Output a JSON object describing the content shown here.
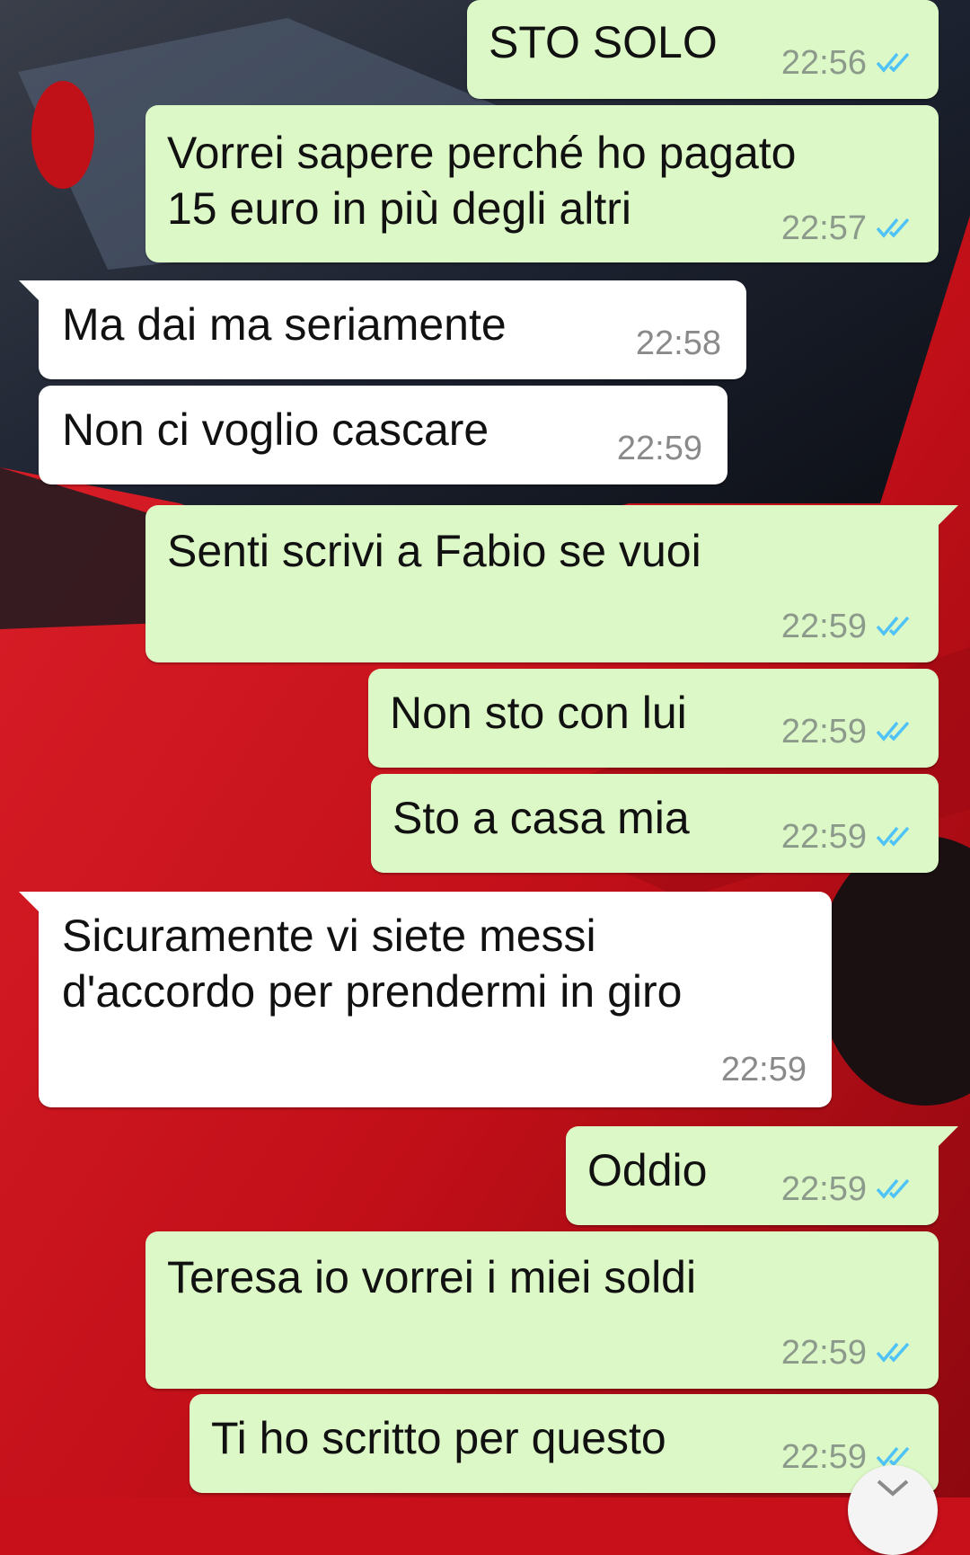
{
  "colors": {
    "outgoing_bubble": "#dcf8c6",
    "incoming_bubble": "#ffffff",
    "read_receipt": "#4fc3f7",
    "wallpaper_red": "#c8101b"
  },
  "messages": [
    {
      "direction": "outgoing",
      "text": "STO SOLO",
      "time": "22:56",
      "status": "read-double-check-icon"
    },
    {
      "direction": "outgoing",
      "text": "Vorrei sapere perché ho pagato\n15 euro in più degli altri",
      "time": "22:57",
      "status": "read-double-check-icon"
    },
    {
      "direction": "incoming",
      "text": "Ma dai ma seriamente",
      "time": "22:58"
    },
    {
      "direction": "incoming",
      "text": "Non ci voglio cascare",
      "time": "22:59"
    },
    {
      "direction": "outgoing",
      "text": "Senti scrivi a Fabio se vuoi",
      "time": "22:59",
      "status": "read-double-check-icon"
    },
    {
      "direction": "outgoing",
      "text": "Non sto con lui",
      "time": "22:59",
      "status": "read-double-check-icon"
    },
    {
      "direction": "outgoing",
      "text": "Sto a casa mia",
      "time": "22:59",
      "status": "read-double-check-icon"
    },
    {
      "direction": "incoming",
      "text": "Sicuramente vi siete messi\nd'accordo per prendermi in giro",
      "time": "22:59"
    },
    {
      "direction": "outgoing",
      "text": "Oddio",
      "time": "22:59",
      "status": "read-double-check-icon"
    },
    {
      "direction": "outgoing",
      "text": "Teresa io vorrei i miei soldi",
      "time": "22:59",
      "status": "read-double-check-icon"
    },
    {
      "direction": "outgoing",
      "text": "Ti ho scritto per questo",
      "time": "22:59",
      "status": "read-double-check-icon"
    }
  ],
  "scroll_button_icon": "chevron-down-icon"
}
